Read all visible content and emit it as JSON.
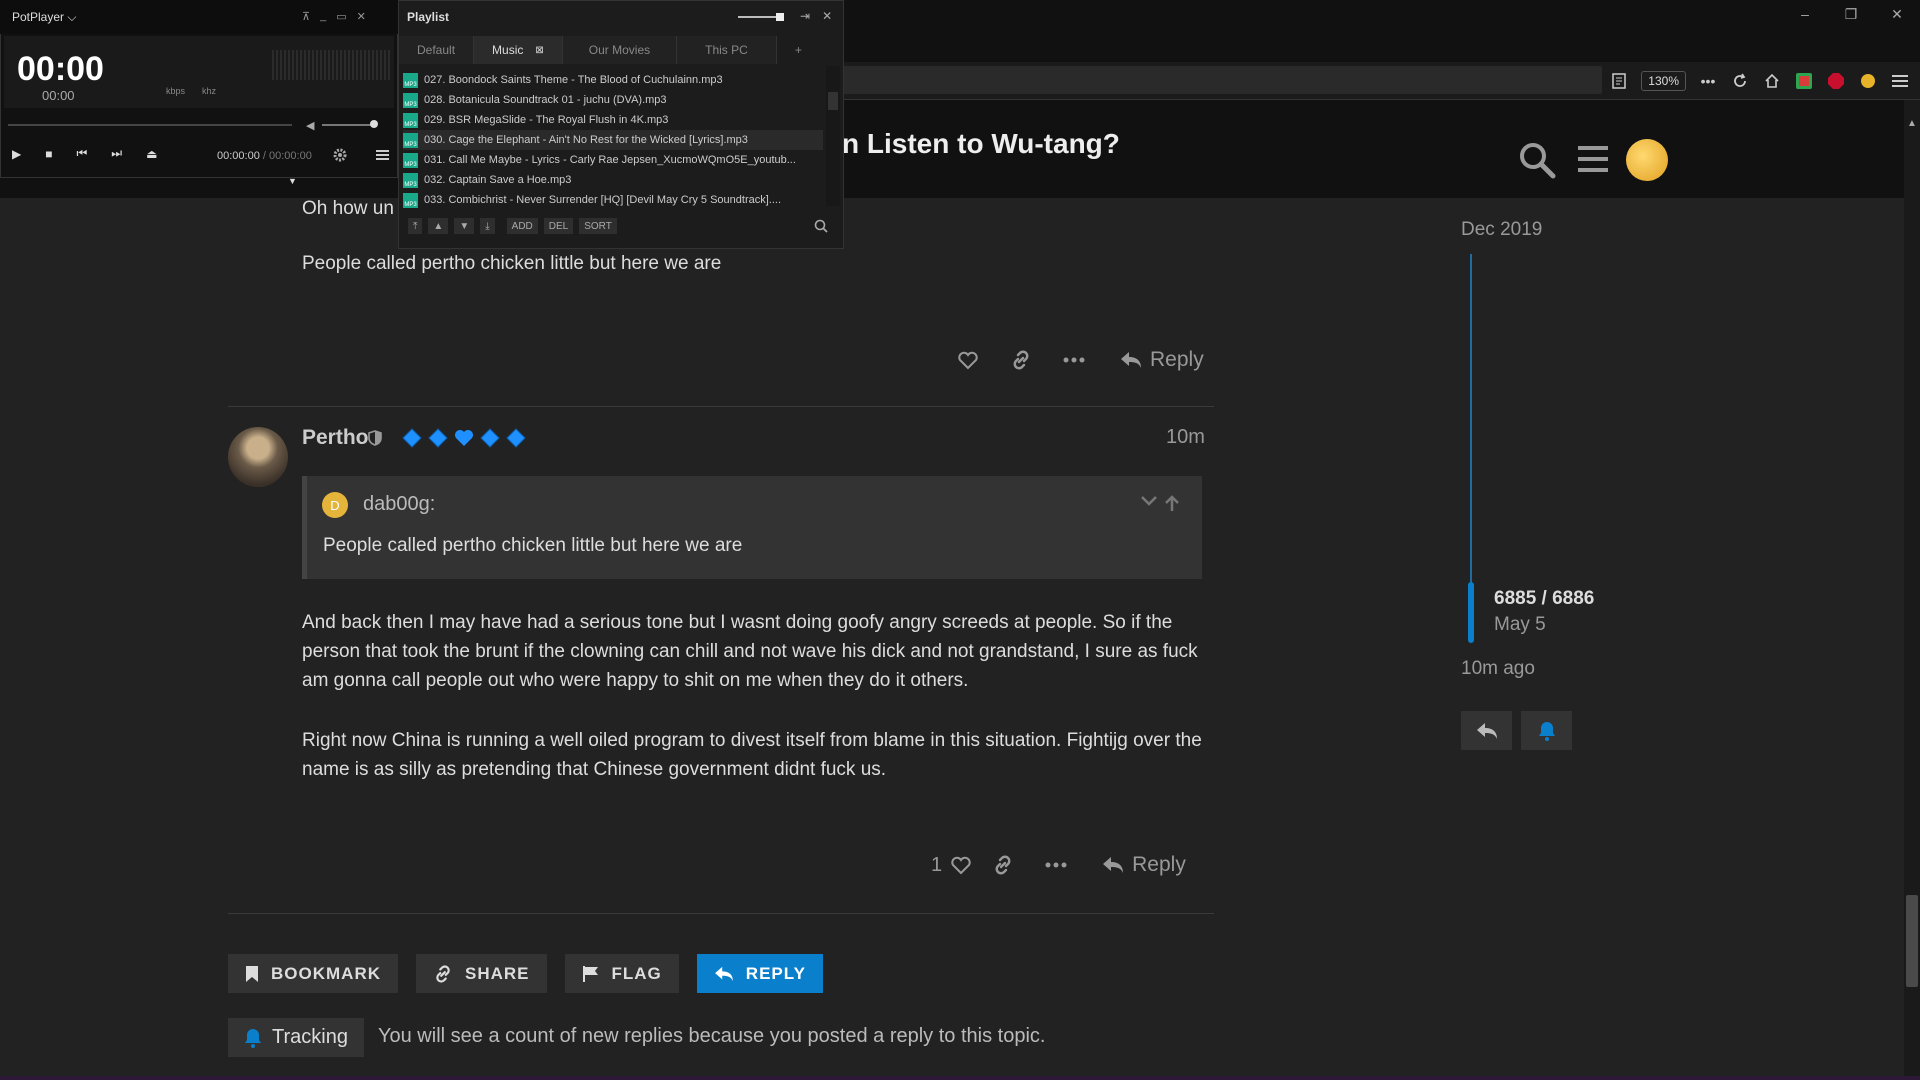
{
  "browser": {
    "zoom": "130%",
    "window_controls": {
      "minimize": "–",
      "restore": "❐",
      "close": "✕"
    }
  },
  "topic": {
    "title": "n Listen to Wu-tang?"
  },
  "post1": {
    "partial_text": "Oh how un",
    "text": "People called pertho chicken little but here we are",
    "reply_label": "Reply"
  },
  "post2": {
    "author": "Pertho",
    "time": "10m",
    "quote": {
      "user": "dab00g:",
      "avatar_letter": "D",
      "text": "People called pertho chicken little but here we are"
    },
    "paragraph1": "And back then I may have had a serious tone but I wasnt doing goofy angry screeds at people. So if the person that took the brunt if the clowning can chill and not wave his dick and not grandstand, I sure as fuck am gonna call people out who were happy to shit on me when they do it others.",
    "paragraph2": "Right now China is running a well oiled program to divest itself from blame in this situation. Fightijg over the name is as silly as pretending that Chinese government didnt fuck us.",
    "like_count": "1",
    "reply_label": "Reply"
  },
  "bottom_buttons": {
    "bookmark": "BOOKMARK",
    "share": "SHARE",
    "flag": "FLAG",
    "reply": "REPLY"
  },
  "tracking": {
    "label": "Tracking",
    "description": "You will see a count of new replies because you posted a reply to this topic."
  },
  "timeline": {
    "date_top": "Dec 2019",
    "count": "6885 / 6886",
    "date_bottom": "May 5",
    "ago": "10m ago"
  },
  "potplayer": {
    "app_name": "PotPlayer",
    "time_main": "00:00",
    "time_sub": "00:00",
    "kbps": "kbps",
    "khz": "khz",
    "position": "00:00:00",
    "duration": "00:00:00"
  },
  "playlist": {
    "title": "Playlist",
    "tabs": [
      "Default",
      "Music",
      "Our Movies",
      "This PC",
      "+"
    ],
    "items": [
      "027. Boondock Saints Theme - The Blood of Cuchulainn.mp3",
      "028. Botanicula Soundtrack 01 - juchu (DVA).mp3",
      "029. BSR MegaSlide - The Royal Flush in 4K.mp3",
      "030. Cage the Elephant - Ain't No Rest for the Wicked [Lyrics].mp3",
      "031. Call Me Maybe - Lyrics - Carly Rae Jepsen_XucmoWQmO5E_youtub...",
      "032. Captain Save a Hoe.mp3",
      "033. Combichrist - Never Surrender [HQ] [Devil May Cry 5 Soundtrack]...."
    ],
    "buttons": {
      "add": "ADD",
      "del": "DEL",
      "sort": "SORT"
    }
  }
}
